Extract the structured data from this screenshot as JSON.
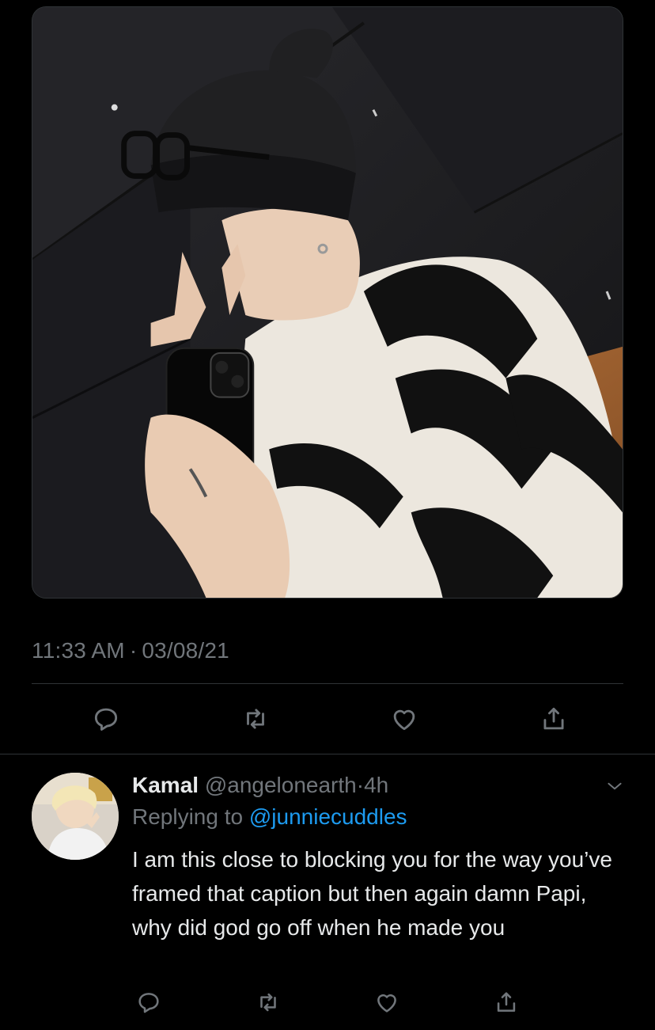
{
  "tweet": {
    "time": "11:33 AM",
    "separator": "·",
    "date": "03/08/21",
    "photo_icon": "photo-mirror-selfie"
  },
  "actions": {
    "reply_icon": "comment-icon",
    "retweet_icon": "retweet-icon",
    "like_icon": "heart-icon",
    "share_icon": "share-icon"
  },
  "reply": {
    "name": "Kamal",
    "handle": "@angelonearth",
    "dot": "·",
    "time": "4h",
    "replying_to_label": "Replying to",
    "replying_to_handle": "@junniecuddles",
    "text": "I am this close to blocking you for the way you’ve framed that caption but then again damn Papi, why did god go off when he made you"
  },
  "colors": {
    "background": "#000000",
    "text_primary": "#e7e9ea",
    "text_secondary": "#71767b",
    "accent": "#1d9bf0",
    "divider": "#2f3336"
  }
}
